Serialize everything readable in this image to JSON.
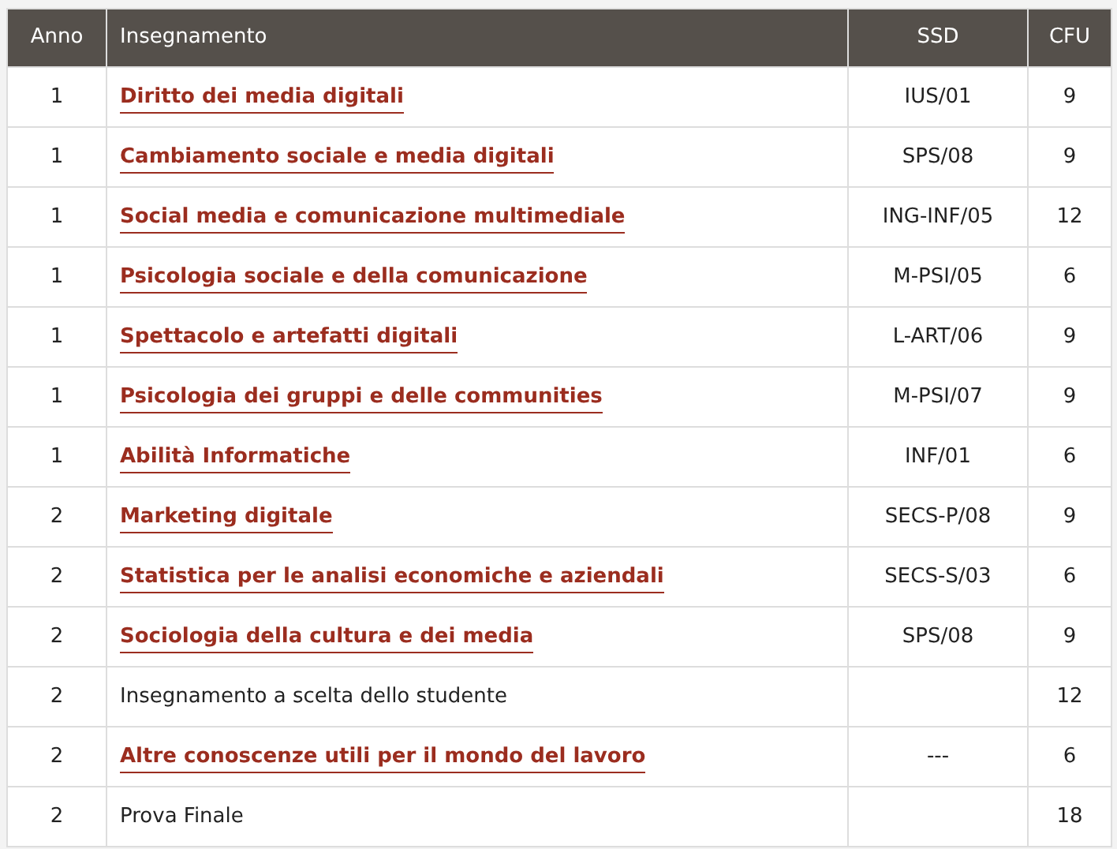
{
  "table": {
    "columns": [
      "Anno",
      "Insegnamento",
      "SSD",
      "CFU"
    ],
    "rows": [
      {
        "anno": "1",
        "insegnamento": "Diritto dei media digitali",
        "link": true,
        "ssd": "IUS/01",
        "cfu": "9"
      },
      {
        "anno": "1",
        "insegnamento": "Cambiamento sociale e media digitali",
        "link": true,
        "ssd": "SPS/08",
        "cfu": "9"
      },
      {
        "anno": "1",
        "insegnamento": "Social media e comunicazione multimediale",
        "link": true,
        "ssd": "ING-INF/05",
        "cfu": "12"
      },
      {
        "anno": "1",
        "insegnamento": "Psicologia sociale e della comunicazione",
        "link": true,
        "ssd": "M-PSI/05",
        "cfu": "6"
      },
      {
        "anno": "1",
        "insegnamento": "Spettacolo e artefatti digitali",
        "link": true,
        "ssd": "L-ART/06",
        "cfu": "9"
      },
      {
        "anno": "1",
        "insegnamento": "Psicologia dei gruppi e delle communities",
        "link": true,
        "ssd": "M-PSI/07",
        "cfu": "9"
      },
      {
        "anno": "1",
        "insegnamento": "Abilità Informatiche",
        "link": true,
        "ssd": "INF/01",
        "cfu": "6"
      },
      {
        "anno": "2",
        "insegnamento": "Marketing digitale",
        "link": true,
        "ssd": "SECS-P/08",
        "cfu": "9"
      },
      {
        "anno": "2",
        "insegnamento": "Statistica per le analisi economiche e aziendali",
        "link": true,
        "ssd": "SECS-S/03",
        "cfu": "6"
      },
      {
        "anno": "2",
        "insegnamento": "Sociologia della cultura e dei media",
        "link": true,
        "ssd": "SPS/08",
        "cfu": "9"
      },
      {
        "anno": "2",
        "insegnamento": "Insegnamento a scelta dello studente",
        "link": false,
        "cfu": "12"
      },
      {
        "anno": "2",
        "insegnamento": "Altre conoscenze utili per il mondo del lavoro",
        "link": true,
        "ssd": "---",
        "cfu": "6"
      },
      {
        "anno": "2",
        "insegnamento": "Prova Finale",
        "link": false,
        "cfu": "18"
      }
    ]
  }
}
